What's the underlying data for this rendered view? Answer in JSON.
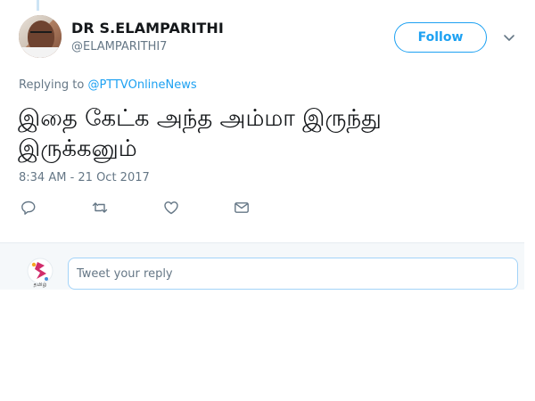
{
  "user": {
    "name": "DR S.ELAMPARITHI",
    "handle": "@ELAMPARITHI7"
  },
  "follow_label": "Follow",
  "replying": {
    "prefix": "Replying to",
    "mention": "@PTTVOnlineNews"
  },
  "tweet": {
    "line1": "இதை கேட்க அந்த அம்மா இருந்து",
    "line2": "இருக்கனும்"
  },
  "timestamp": "8:34 AM - 21 Oct 2017",
  "actions": {
    "icons": [
      "reply-icon",
      "retweet-icon",
      "like-icon",
      "message-icon"
    ]
  },
  "reply_box": {
    "placeholder": "Tweet your reply",
    "avatar_text": "தமிழ்"
  },
  "colors": {
    "accent": "#1da1f2",
    "muted": "#657786",
    "text": "#14171a",
    "reply_bg": "#f5f8fa"
  }
}
